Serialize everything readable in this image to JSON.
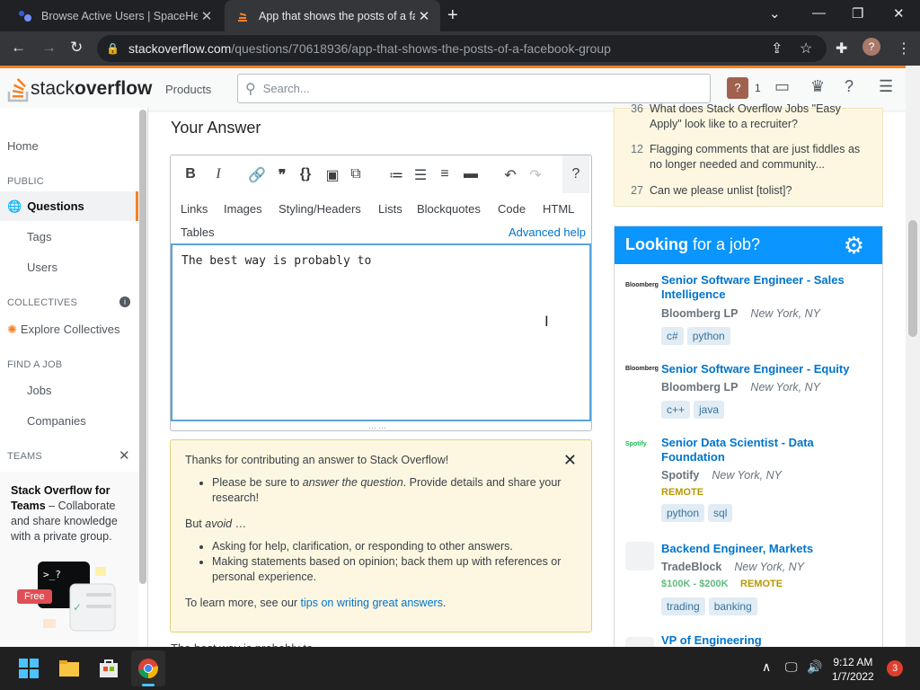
{
  "browser": {
    "tabs": [
      {
        "title": "Browse Active Users | SpaceHey",
        "active": false
      },
      {
        "title": "App that shows the posts of a facebook group",
        "active": true
      }
    ],
    "new_tab": "+",
    "url_host": "stackoverflow.com",
    "url_path": "/questions/70618936/app-that-shows-the-posts-of-a-facebook-group",
    "profile_initial": "?"
  },
  "so_header": {
    "logo_light": "stack",
    "logo_bold": "overflow",
    "products": "Products",
    "search_placeholder": "Search...",
    "rep_badge": "?",
    "rep_count": "1"
  },
  "left_nav": {
    "home": "Home",
    "public_head": "PUBLIC",
    "questions": "Questions",
    "tags": "Tags",
    "users": "Users",
    "collectives_head": "COLLECTIVES",
    "explore_collectives": "Explore Collectives",
    "find_job_head": "FIND A JOB",
    "jobs": "Jobs",
    "companies": "Companies",
    "teams_head": "TEAMS",
    "teams_title": "Stack Overflow for Teams",
    "teams_desc": " – Collaborate and share knowledge with a private group.",
    "free_badge": "Free"
  },
  "answer": {
    "heading": "Your Answer",
    "help_tabs": [
      "Links",
      "Images",
      "Styling/Headers",
      "Lists",
      "Blockquotes",
      "Code",
      "HTML"
    ],
    "tables": "Tables",
    "advanced_help": "Advanced help",
    "text": "The best way is probably to"
  },
  "notice": {
    "title": "Thanks for contributing an answer to Stack Overflow!",
    "bullet1_pre": "Please be sure to ",
    "bullet1_em": "answer the question",
    "bullet1_post": ". Provide details and share your research!",
    "avoid_pre": "But ",
    "avoid_em": "avoid",
    "avoid_post": " …",
    "bullet2": "Asking for help, clarification, or responding to other answers.",
    "bullet3": "Making statements based on opinion; back them up with references or personal experience.",
    "learn_pre": "To learn more, see our ",
    "learn_link": "tips on writing great answers",
    "learn_post": ".",
    "bottom_preview": "The best way is probably to"
  },
  "meta": [
    {
      "num": "36",
      "text": "What does Stack Overflow Jobs \"Easy Apply\" look like to a recruiter?"
    },
    {
      "num": "12",
      "text": "Flagging comments that are just fiddles as no longer needed and community..."
    },
    {
      "num": "27",
      "text": "Can we please unlist [tolist]?"
    }
  ],
  "jobs": {
    "head_bold": "Looking",
    "head_rest": " for a job?",
    "listings": [
      {
        "logo": "Bloomberg",
        "title": "Senior Software Engineer - Sales Intelligence",
        "company": "Bloomberg LP",
        "location": "New York, NY",
        "tags": [
          "c#",
          "python"
        ],
        "remote": "",
        "salary": ""
      },
      {
        "logo": "Bloomberg",
        "title": "Senior Software Engineer - Equity",
        "company": "Bloomberg LP",
        "location": "New York, NY",
        "tags": [
          "c++",
          "java"
        ],
        "remote": "",
        "salary": ""
      },
      {
        "logo": "Spotify",
        "title": "Senior Data Scientist - Data Foundation",
        "company": "Spotify",
        "location": "New York, NY",
        "tags": [
          "python",
          "sql"
        ],
        "remote": "REMOTE",
        "salary": ""
      },
      {
        "logo": "",
        "title": "Backend Engineer, Markets",
        "company": "TradeBlock",
        "location": "New York, NY",
        "tags": [
          "trading",
          "banking"
        ],
        "remote": "REMOTE",
        "salary": "$100K - $200K"
      },
      {
        "logo": "",
        "title": "VP of Engineering",
        "company": "",
        "location": "",
        "tags": [],
        "remote": "",
        "salary": ""
      }
    ]
  },
  "taskbar": {
    "time": "9:12 AM",
    "date": "1/7/2022",
    "notifications": "3"
  },
  "colors": {
    "so_orange": "#f48225",
    "link_blue": "#0074cc",
    "jobs_blue": "#0a95ff"
  }
}
